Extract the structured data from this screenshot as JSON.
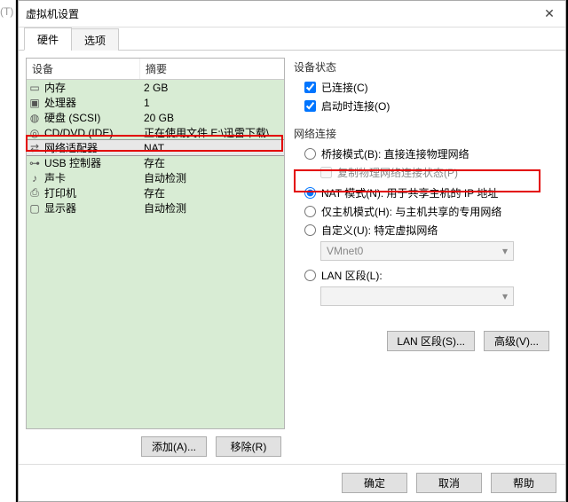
{
  "outer_left_label": "(T)",
  "dialog": {
    "title": "虚拟机设置"
  },
  "tabs": {
    "hardware": "硬件",
    "options": "选项"
  },
  "list_header": {
    "device": "设备",
    "summary": "摘要"
  },
  "devices": [
    {
      "icon": "memory-icon",
      "name": "内存",
      "summary": "2 GB"
    },
    {
      "icon": "cpu-icon",
      "name": "处理器",
      "summary": "1"
    },
    {
      "icon": "hdd-icon",
      "name": "硬盘 (SCSI)",
      "summary": "20 GB"
    },
    {
      "icon": "cd-icon",
      "name": "CD/DVD (IDE)",
      "summary": "正在使用文件 E:\\迅雷下载\\Cen..."
    },
    {
      "icon": "nic-icon",
      "name": "网络适配器",
      "summary": "NAT"
    },
    {
      "icon": "usb-icon",
      "name": "USB 控制器",
      "summary": "存在"
    },
    {
      "icon": "sound-icon",
      "name": "声卡",
      "summary": "自动检测"
    },
    {
      "icon": "printer-icon",
      "name": "打印机",
      "summary": "存在"
    },
    {
      "icon": "display-icon",
      "name": "显示器",
      "summary": "自动检测"
    }
  ],
  "left_buttons": {
    "add": "添加(A)...",
    "remove": "移除(R)"
  },
  "status_group": {
    "title": "设备状态",
    "connected": "已连接(C)",
    "connect_at_poweron": "启动时连接(O)"
  },
  "network_group": {
    "title": "网络连接",
    "bridged": "桥接模式(B): 直接连接物理网络",
    "replicate": "复制物理网络连接状态(P)",
    "nat": "NAT 模式(N): 用于共享主机的 IP 地址",
    "hostonly": "仅主机模式(H): 与主机共享的专用网络",
    "custom": "自定义(U): 特定虚拟网络",
    "vmnet_value": "VMnet0",
    "lan_segment": "LAN 区段(L):"
  },
  "right_buttons": {
    "lan_segments": "LAN 区段(S)...",
    "advanced": "高级(V)..."
  },
  "footer": {
    "ok": "确定",
    "cancel": "取消",
    "help": "帮助"
  },
  "colors": {
    "highlight_red": "#e30000",
    "list_bg": "#d8ecd4"
  }
}
